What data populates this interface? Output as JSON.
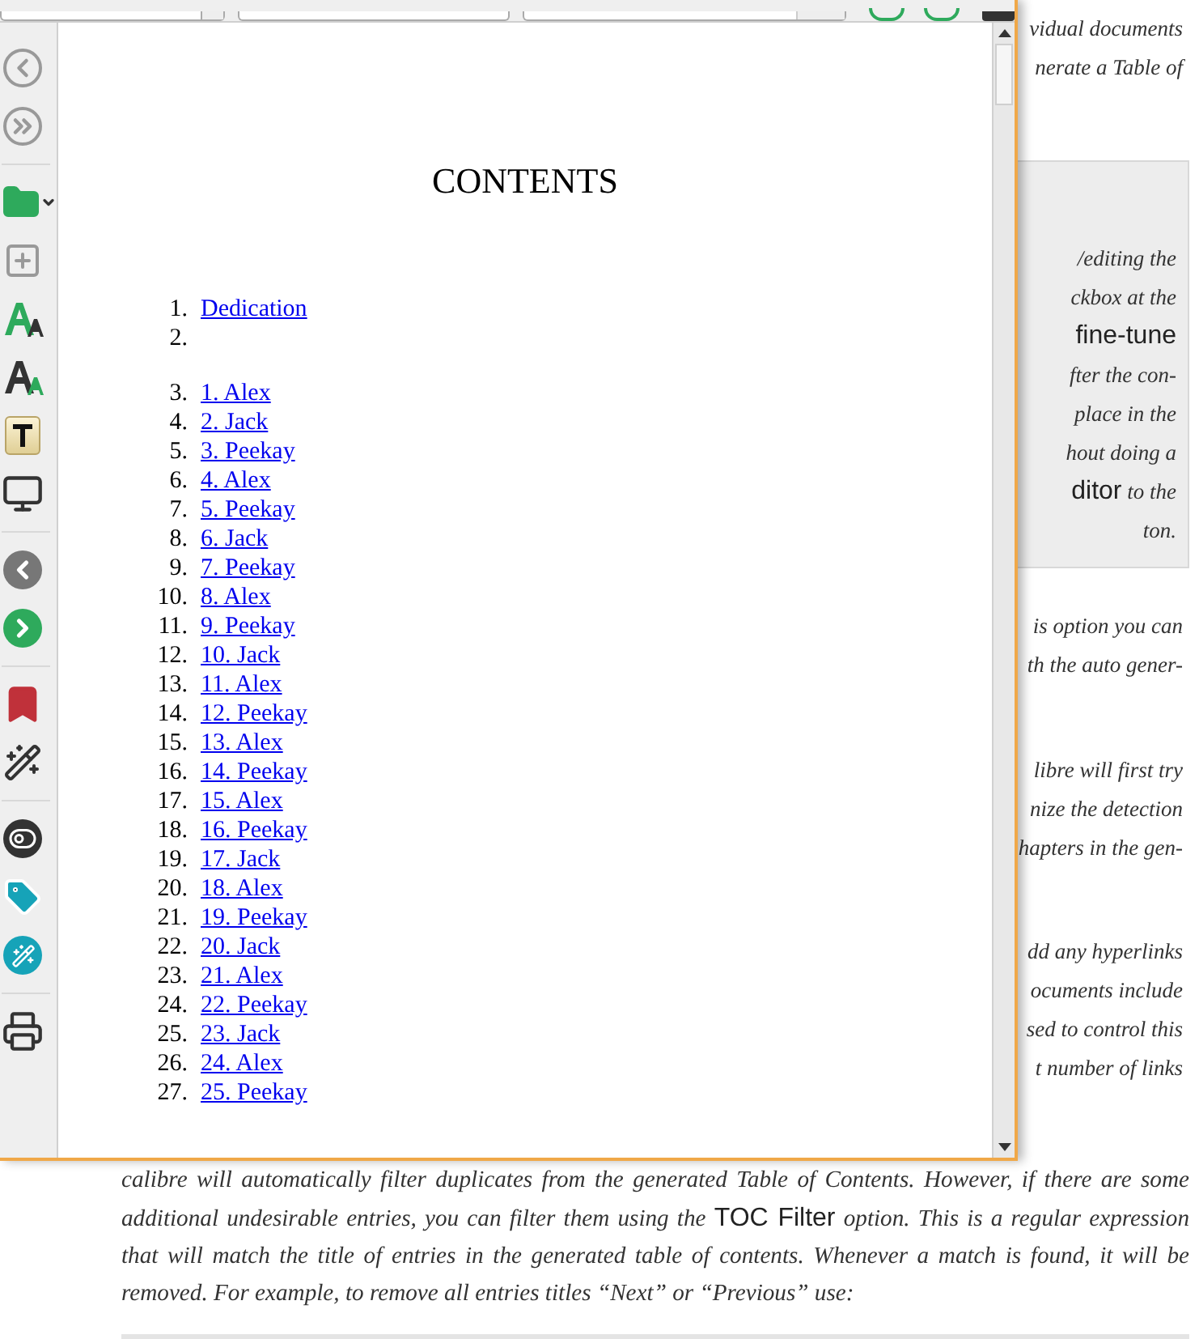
{
  "background": {
    "groups": [
      {
        "kind": "plain",
        "lines": [
          [
            {
              "kind": "text",
              "text": "vidual documents"
            }
          ],
          [
            {
              "kind": "text",
              "text": "nerate a Table of"
            }
          ]
        ]
      },
      {
        "kind": "note",
        "lines": [
          [
            {
              "kind": "text",
              "text": "/editing the"
            }
          ],
          [
            {
              "kind": "text",
              "text": "ckbox at the"
            }
          ],
          [
            {
              "kind": "ui",
              "text": "fine-tune"
            }
          ],
          [
            {
              "kind": "text",
              "text": "fter the con-"
            }
          ],
          [
            {
              "kind": "text",
              "text": "place in the"
            }
          ],
          [
            {
              "kind": "text",
              "text": "hout doing a"
            }
          ],
          [
            {
              "kind": "ui",
              "text": "ditor"
            },
            {
              "kind": "text",
              "text": " to the"
            }
          ],
          [
            {
              "kind": "text",
              "text": "ton."
            }
          ]
        ]
      },
      {
        "kind": "plain",
        "lines": [
          [
            {
              "kind": "text",
              "text": "is option you can"
            }
          ],
          [
            {
              "kind": "text",
              "text": "th the auto gener-"
            }
          ]
        ]
      },
      {
        "kind": "plain",
        "lines": [
          [
            {
              "kind": "text",
              "text": "libre will first try"
            }
          ],
          [
            {
              "kind": "text",
              "text": "nize the detection"
            }
          ],
          [
            {
              "kind": "text",
              "text": "hapters in the gen-"
            }
          ]
        ]
      },
      {
        "kind": "plain",
        "lines": [
          [
            {
              "kind": "text",
              "text": "dd any hyperlinks"
            }
          ],
          [
            {
              "kind": "text",
              "text": "ocuments include"
            }
          ],
          [
            {
              "kind": "text",
              "text": "sed to control this"
            }
          ],
          [
            {
              "kind": "text",
              "text": "t number of links"
            }
          ]
        ]
      }
    ],
    "paragraph": [
      {
        "kind": "text",
        "text": "calibre will automatically filter duplicates from the generated Table of Contents. However, if there are some additional undesirable entries, you can filter them using the "
      },
      {
        "kind": "ui",
        "text": "TOC Filter"
      },
      {
        "kind": "text",
        "text": " option. This is a regular expression that will match the title of entries in the generated table of contents. Whenever a match is found, it will be removed. For example, to remove all entries titles “Next” or “Previous” use:"
      }
    ]
  },
  "viewer": {
    "heading": "CONTENTS",
    "entries": [
      {
        "kind": "link",
        "number": "1.",
        "text": "Dedication"
      },
      {
        "kind": "blank",
        "number": "2."
      },
      {
        "kind": "link",
        "number": "3.",
        "text": "1. Alex"
      },
      {
        "kind": "link",
        "number": "4.",
        "text": "2. Jack"
      },
      {
        "kind": "link",
        "number": "5.",
        "text": "3. Peekay"
      },
      {
        "kind": "link",
        "number": "6.",
        "text": "4. Alex"
      },
      {
        "kind": "link",
        "number": "7.",
        "text": "5. Peekay"
      },
      {
        "kind": "link",
        "number": "8.",
        "text": "6. Jack"
      },
      {
        "kind": "link",
        "number": "9.",
        "text": "7. Peekay"
      },
      {
        "kind": "link",
        "number": "10.",
        "text": "8. Alex"
      },
      {
        "kind": "link",
        "number": "11.",
        "text": "9. Peekay"
      },
      {
        "kind": "link",
        "number": "12.",
        "text": "10. Jack"
      },
      {
        "kind": "link",
        "number": "13.",
        "text": "11. Alex"
      },
      {
        "kind": "link",
        "number": "14.",
        "text": "12. Peekay"
      },
      {
        "kind": "link",
        "number": "15.",
        "text": "13. Alex"
      },
      {
        "kind": "link",
        "number": "16.",
        "text": "14. Peekay"
      },
      {
        "kind": "link",
        "number": "17.",
        "text": "15. Alex"
      },
      {
        "kind": "link",
        "number": "18.",
        "text": "16. Peekay"
      },
      {
        "kind": "link",
        "number": "19.",
        "text": "17. Jack"
      },
      {
        "kind": "link",
        "number": "20.",
        "text": "18. Alex"
      },
      {
        "kind": "link",
        "number": "21.",
        "text": "19. Peekay"
      },
      {
        "kind": "link",
        "number": "22.",
        "text": "20. Jack"
      },
      {
        "kind": "link",
        "number": "23.",
        "text": "21. Alex"
      },
      {
        "kind": "link",
        "number": "24.",
        "text": "22. Peekay"
      },
      {
        "kind": "link",
        "number": "25.",
        "text": "23. Jack"
      },
      {
        "kind": "link",
        "number": "26.",
        "text": "24. Alex"
      },
      {
        "kind": "link",
        "number": "27.",
        "text": "25. Peekay"
      }
    ]
  }
}
